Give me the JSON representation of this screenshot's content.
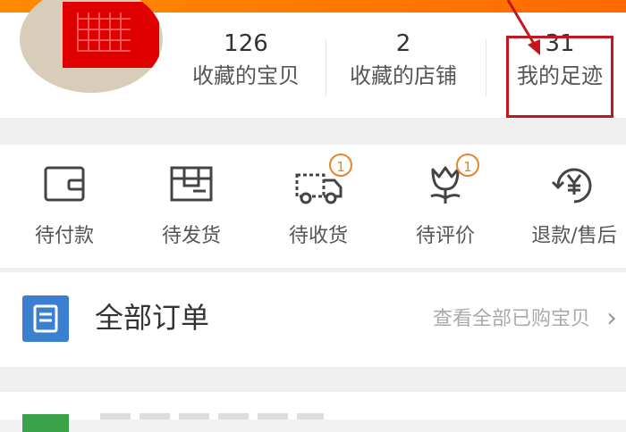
{
  "header": {
    "accent_color": "#ff7a00"
  },
  "stats": [
    {
      "value": "126",
      "label": "收藏的宝贝"
    },
    {
      "value": "2",
      "label": "收藏的店铺"
    },
    {
      "value": "31",
      "label": "我的足迹"
    }
  ],
  "order_status": [
    {
      "label": "待付款",
      "icon": "wallet-icon"
    },
    {
      "label": "待发货",
      "icon": "package-icon"
    },
    {
      "label": "待收货",
      "icon": "truck-icon",
      "badge": "1"
    },
    {
      "label": "待评价",
      "icon": "flower-icon",
      "badge": "1"
    },
    {
      "label": "退款/售后",
      "icon": "refund-icon"
    }
  ],
  "orders": {
    "title": "全部订单",
    "link": "查看全部已购宝贝"
  },
  "colors": {
    "highlight": "#c4161c",
    "badge": "#e5852a",
    "order_icon": "#3b7fd1"
  }
}
